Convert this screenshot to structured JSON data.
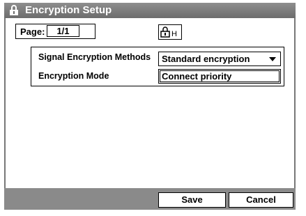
{
  "window": {
    "title": "Encryption Setup"
  },
  "page": {
    "label": "Page:",
    "value": "1/1"
  },
  "status": {
    "encryption_indicator_text": "H"
  },
  "settings": {
    "rows": [
      {
        "label": "Signal Encryption Methods",
        "value": "Standard encryption"
      },
      {
        "label": "Encryption Mode",
        "value": "Connect priority"
      }
    ]
  },
  "footer": {
    "save_label": "Save",
    "cancel_label": "Cancel"
  },
  "icons": {
    "title_lock": "lock-icon",
    "encryption_status": "lock-h-icon"
  },
  "colors": {
    "title_bar": "#7d7d7d",
    "footer_bar": "#8a8a8a"
  }
}
